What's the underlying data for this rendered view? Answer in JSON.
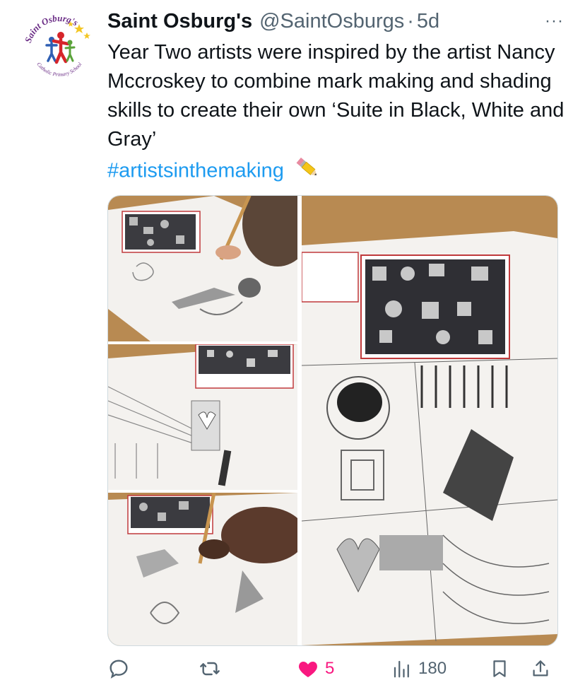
{
  "tweet": {
    "display_name": "Saint Osburg's",
    "handle": "@SaintOsburgs",
    "separator": "·",
    "time": "5d",
    "text": "Year Two artists were inspired by the artist Nancy Mccroskey to combine mark making and shading skills to create their own ‘Suite in Black, White and Gray’",
    "hashtag": "#artistsinthemaking",
    "more_label": "···"
  },
  "avatar": {
    "logo_text_top": "Saint Osburg's",
    "logo_text_bottom": "Catholic Primary School"
  },
  "media": {
    "photos": [
      {
        "icon": "photo-child-drawing-top"
      },
      {
        "icon": "photo-sketchbook-closeup"
      },
      {
        "icon": "photo-child-drawing-bottom"
      },
      {
        "icon": "photo-sketchbook-page"
      }
    ]
  },
  "actions": {
    "reply_count": "",
    "retweet_count": "",
    "like_count": "5",
    "views_count": "180"
  },
  "colors": {
    "text": "#0f1419",
    "secondary": "#536471",
    "link": "#1d9bf0",
    "like": "#f91880"
  }
}
